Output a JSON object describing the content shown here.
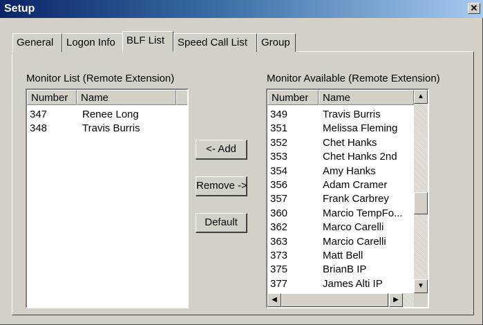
{
  "window": {
    "title": "Setup",
    "close_glyph": "✕"
  },
  "tabs": [
    {
      "label": "General"
    },
    {
      "label": "Logon Info"
    },
    {
      "label": "BLF List"
    },
    {
      "label": "Speed Call List"
    },
    {
      "label": "Group"
    }
  ],
  "active_tab": "BLF List",
  "monitor_list": {
    "label": "Monitor List (Remote Extension)",
    "columns": [
      "Number",
      "Name"
    ],
    "rows": [
      {
        "number": "347",
        "name": "Renee Long"
      },
      {
        "number": "348",
        "name": "Travis Burris"
      }
    ]
  },
  "buttons": {
    "add": "<- Add",
    "remove": "Remove ->",
    "default": "Default"
  },
  "monitor_available": {
    "label": "Monitor Available (Remote Extension)",
    "columns": [
      "Number",
      "Name"
    ],
    "rows": [
      {
        "number": "349",
        "name": "Travis Burris"
      },
      {
        "number": "351",
        "name": "Melissa Fleming"
      },
      {
        "number": "352",
        "name": "Chet Hanks"
      },
      {
        "number": "353",
        "name": "Chet Hanks 2nd"
      },
      {
        "number": "354",
        "name": "Amy Hanks"
      },
      {
        "number": "356",
        "name": "Adam Cramer"
      },
      {
        "number": "357",
        "name": "Frank Carbrey"
      },
      {
        "number": "360",
        "name": "Marcio TempFo..."
      },
      {
        "number": "362",
        "name": "Marco Carelli"
      },
      {
        "number": "363",
        "name": "Marcio Carelli"
      },
      {
        "number": "373",
        "name": "Matt Bell"
      },
      {
        "number": "375",
        "name": "BrianB IP"
      },
      {
        "number": "377",
        "name": "James Alti IP"
      }
    ]
  },
  "icons": {
    "scroll_up": "▲",
    "scroll_down": "▼",
    "scroll_left": "◀",
    "scroll_right": "▶"
  }
}
